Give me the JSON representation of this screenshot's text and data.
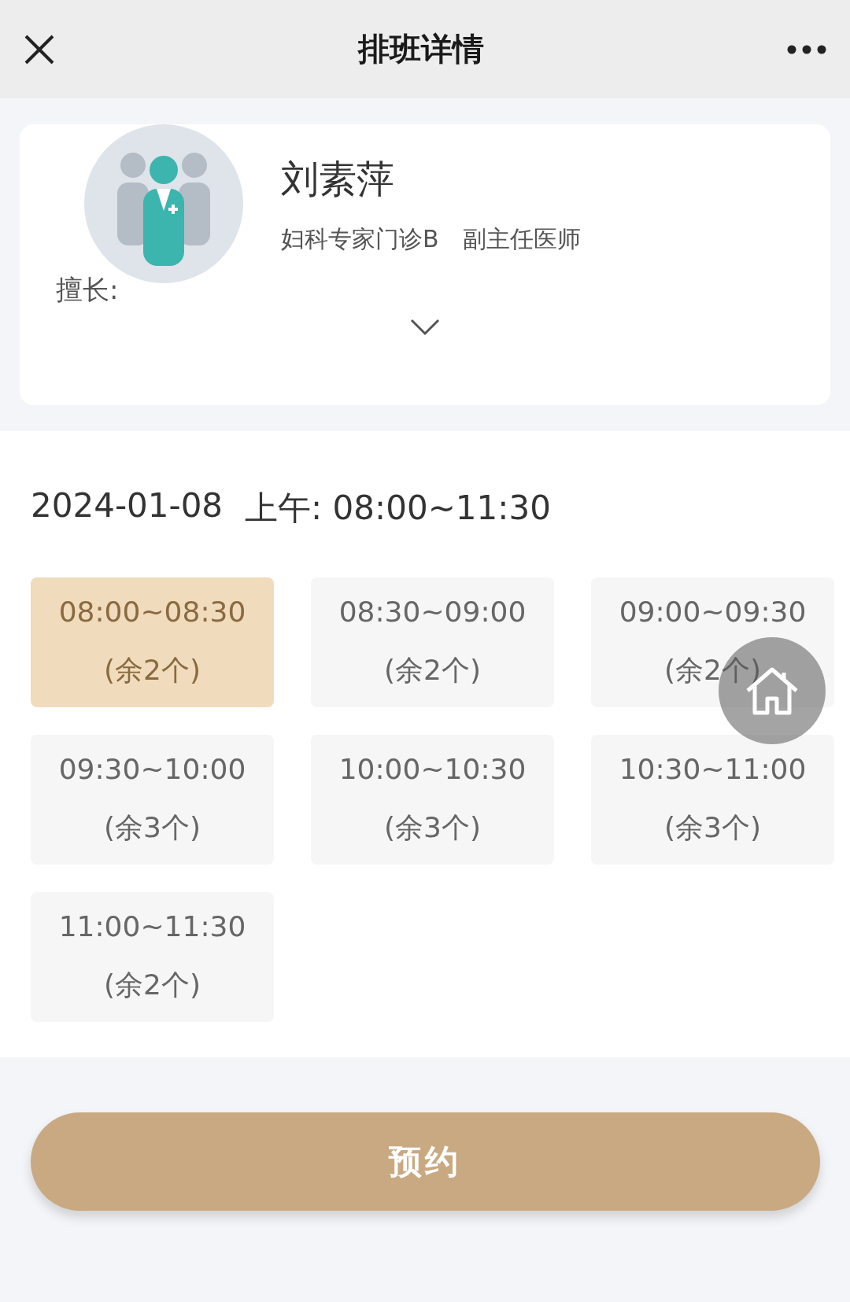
{
  "header": {
    "title": "排班详情"
  },
  "doctor": {
    "name": "刘素萍",
    "department": "妇科专家门诊B",
    "rank": "副主任医师",
    "specialty_label": "擅长:",
    "expanded": false
  },
  "schedule": {
    "date": "2024-01-08",
    "period": "上午: 08:00~11:30"
  },
  "slots": [
    {
      "time": "08:00~08:30",
      "remaining": "(余2个)",
      "selected": true
    },
    {
      "time": "08:30~09:00",
      "remaining": "(余2个)",
      "selected": false
    },
    {
      "time": "09:00~09:30",
      "remaining": "(余2个)",
      "selected": false
    },
    {
      "time": "09:30~10:00",
      "remaining": "(余3个)",
      "selected": false
    },
    {
      "time": "10:00~10:30",
      "remaining": "(余3个)",
      "selected": false
    },
    {
      "time": "10:30~11:00",
      "remaining": "(余3个)",
      "selected": false
    },
    {
      "time": "11:00~11:30",
      "remaining": "(余2个)",
      "selected": false
    }
  ],
  "book_button": "预约"
}
